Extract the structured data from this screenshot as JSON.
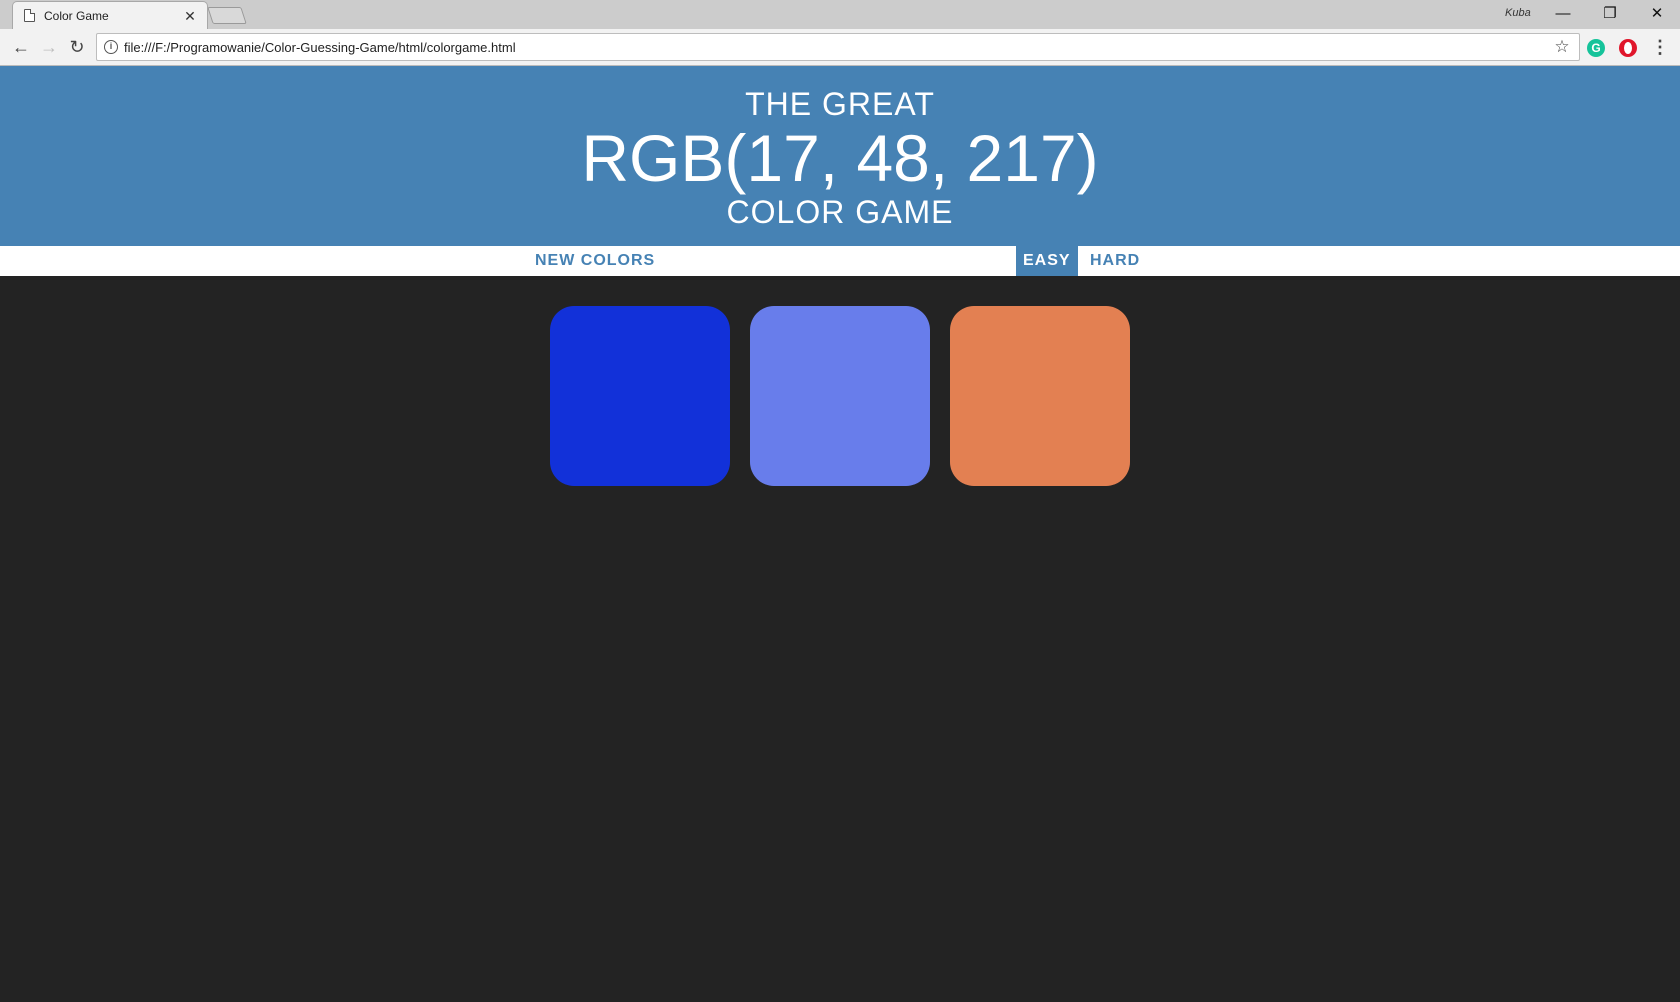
{
  "browser": {
    "tab_title": "Color Game",
    "tab_close_glyph": "✕",
    "profile_name": "Kuba",
    "window_buttons": {
      "minimize": "—",
      "restore": "❐",
      "close": "✕"
    },
    "nav": {
      "back": "←",
      "forward": "→",
      "reload": "↻"
    },
    "url": "file:///F:/Programowanie/Color-Guessing-Game/html/colorgame.html",
    "info_glyph": "i",
    "star_glyph": "☆",
    "grammarly_glyph": "G",
    "menu_glyph": "⋮"
  },
  "header": {
    "line1": "The Great",
    "target_color": "RGB(17, 48, 217)",
    "line3": "Color Game",
    "background": "#4682b4"
  },
  "stripe": {
    "new_colors": "New Colors",
    "easy": "Easy",
    "hard": "Hard",
    "selected_mode": "easy"
  },
  "squares": [
    {
      "color": "#1231d9"
    },
    {
      "color": "#687deb"
    },
    {
      "color": "#e38052"
    }
  ],
  "page_background": "#232323"
}
